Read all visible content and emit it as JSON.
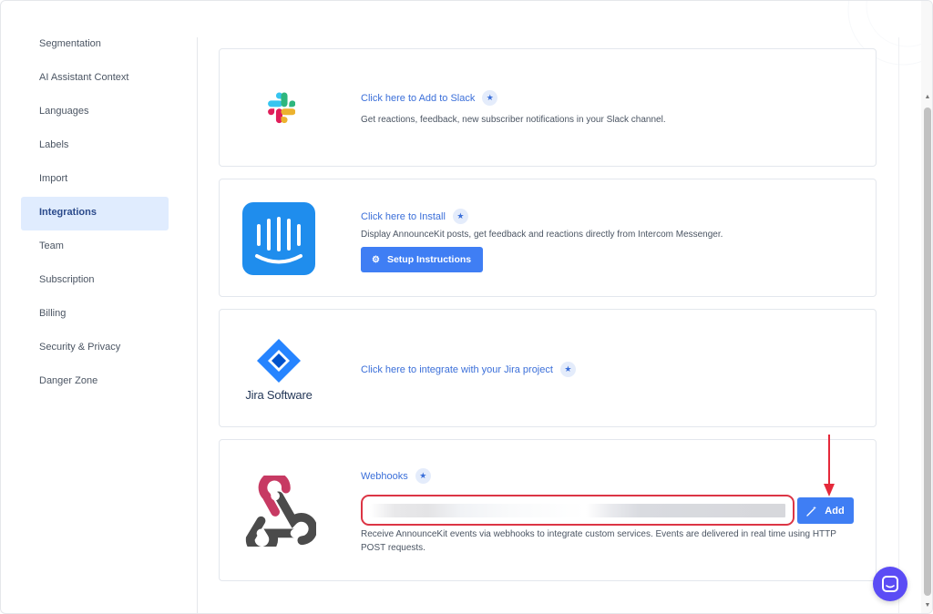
{
  "sidebar": {
    "items": [
      {
        "label": "Segmentation"
      },
      {
        "label": "AI Assistant Context"
      },
      {
        "label": "Languages"
      },
      {
        "label": "Labels"
      },
      {
        "label": "Import"
      },
      {
        "label": "Integrations",
        "active": true
      },
      {
        "label": "Team"
      },
      {
        "label": "Subscription"
      },
      {
        "label": "Billing"
      },
      {
        "label": "Security & Privacy"
      },
      {
        "label": "Danger Zone"
      }
    ]
  },
  "integrations": {
    "slack": {
      "link": "Click here to Add to Slack",
      "description": "Get reactions, feedback, new subscriber notifications in your Slack channel.",
      "icon": "slack-logo"
    },
    "intercom": {
      "link": "Click here to Install",
      "description": "Display AnnounceKit posts, get feedback and reactions directly from Intercom Messenger.",
      "button": "Setup Instructions",
      "icon": "intercom-logo"
    },
    "jira": {
      "link": "Click here to integrate with your Jira project",
      "logo_text": "Jira Software",
      "icon": "jira-logo"
    },
    "webhooks": {
      "title": "Webhooks",
      "input_value": "",
      "add_button": "Add",
      "description": "Receive AnnounceKit events via webhooks to integrate custom services. Events are delivered in real time using HTTP POST requests.",
      "icon": "webhook-logo"
    }
  },
  "colors": {
    "accent": "#3f7ef4",
    "link": "#3b6fd9",
    "highlight": "#dc3545",
    "chat": "#5b4cf5",
    "sidebar_active_bg": "#e0ecfe"
  }
}
